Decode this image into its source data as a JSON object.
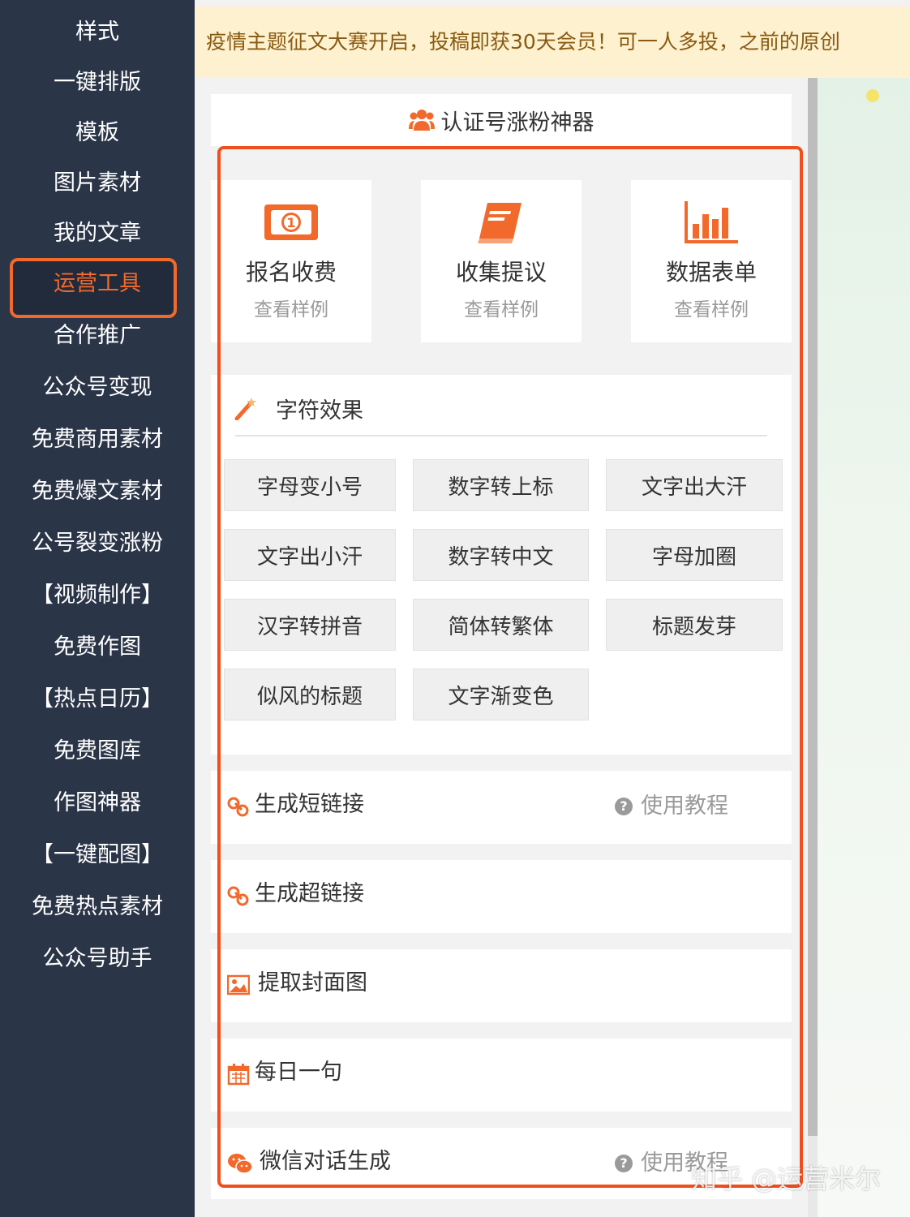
{
  "sidebar": {
    "items": [
      {
        "label": "样式"
      },
      {
        "label": "一键排版"
      },
      {
        "label": "模板"
      },
      {
        "label": "图片素材"
      },
      {
        "label": "我的文章"
      },
      {
        "label": "运营工具"
      },
      {
        "label": "合作推广"
      },
      {
        "label": "公众号变现"
      },
      {
        "label": "免费商用素材"
      },
      {
        "label": "免费爆文素材"
      },
      {
        "label": "公号裂变涨粉"
      },
      {
        "label": "【视频制作】"
      },
      {
        "label": "免费作图"
      },
      {
        "label": "【热点日历】"
      },
      {
        "label": "免费图库"
      },
      {
        "label": "作图神器"
      },
      {
        "label": "【一键配图】"
      },
      {
        "label": "免费热点素材"
      },
      {
        "label": "公众号助手"
      }
    ],
    "active_label": "运营工具"
  },
  "banner": {
    "text": "疫情主题征文大赛开启，投稿即获30天会员！可一人多投，之前的原创"
  },
  "panel": {
    "title": "认证号涨粉神器",
    "cards": [
      {
        "title": "报名收费",
        "sub": "查看样例",
        "icon": "money-icon"
      },
      {
        "title": "收集提议",
        "sub": "查看样例",
        "icon": "book-icon"
      },
      {
        "title": "数据表单",
        "sub": "查看样例",
        "icon": "bar-chart-icon"
      }
    ],
    "effects": {
      "title": "字符效果",
      "buttons": [
        "字母变小号",
        "数字转上标",
        "文字出大汗",
        "文字出小汗",
        "数字转中文",
        "字母加圈",
        "汉字转拼音",
        "简体转繁体",
        "标题发芽",
        "似风的标题",
        "文字渐变色"
      ]
    },
    "rows": [
      {
        "label": "生成短链接",
        "help": "使用教程",
        "icon": "link-icon"
      },
      {
        "label": "生成超链接",
        "icon": "link-icon"
      },
      {
        "label": "提取封面图",
        "icon": "image-icon"
      },
      {
        "label": "每日一句",
        "icon": "calendar-icon"
      },
      {
        "label": "微信对话生成",
        "help": "使用教程",
        "icon": "wechat-icon"
      }
    ]
  },
  "watermark": "知乎 @运营米尔",
  "colors": {
    "accent": "#f2692c",
    "highlight": "#f04e1c",
    "sidebar_bg": "#2b3548",
    "banner_bg": "#fdf1cf"
  }
}
